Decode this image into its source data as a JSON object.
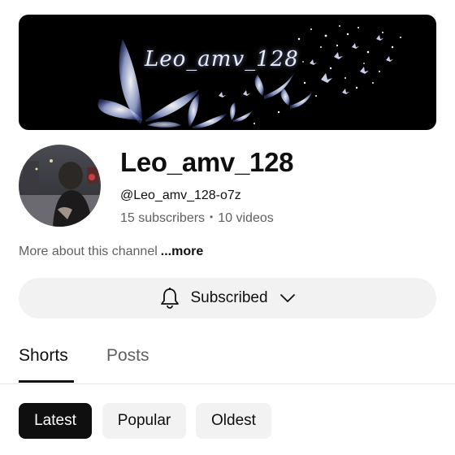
{
  "banner": {
    "title": "Leo_amv_128"
  },
  "channel": {
    "name": "Leo_amv_128",
    "handle": "@Leo_amv_128-o7z",
    "subscribers": "15 subscribers",
    "videos": "10 videos",
    "separator": "•",
    "about": "More about this channel",
    "more_link": "...more"
  },
  "subscribe_button": {
    "label": "Subscribed",
    "icon": "bell-icon",
    "dropdown_icon": "chevron-down-icon"
  },
  "tabs": [
    {
      "label": "Shorts",
      "selected": true
    },
    {
      "label": "Posts",
      "selected": false
    }
  ],
  "chips": [
    {
      "label": "Latest",
      "selected": true
    },
    {
      "label": "Popular",
      "selected": false
    },
    {
      "label": "Oldest",
      "selected": false
    }
  ],
  "colors": {
    "text_primary": "#0f0f0f",
    "text_secondary": "#606060",
    "chip_bg": "#f2f2f2",
    "chip_active_bg": "#0f0f0f",
    "banner_bg": "#000000"
  }
}
